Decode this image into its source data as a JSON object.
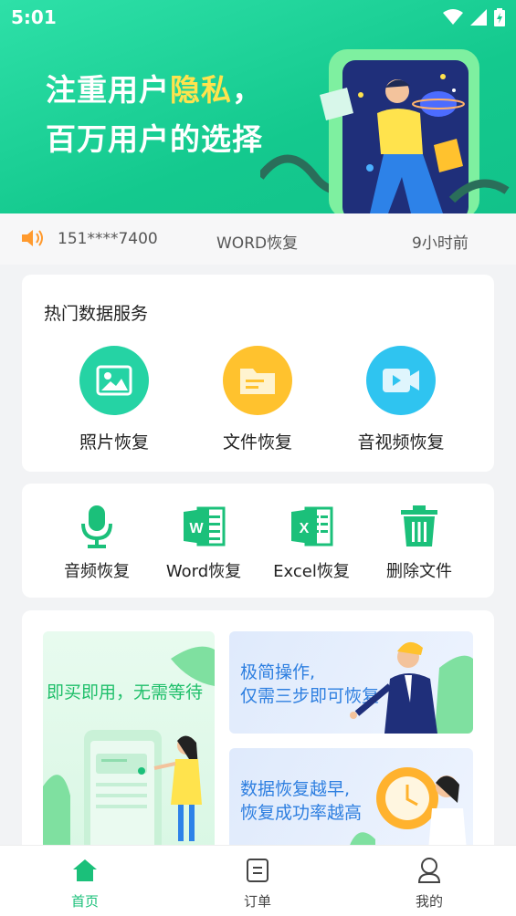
{
  "status_bar": {
    "time": "5:01"
  },
  "hero": {
    "line1_prefix": "注重用户",
    "line1_highlight": "隐私",
    "line1_suffix": "，",
    "line2": "百万用户的选择"
  },
  "ticker": {
    "phone": "151****7400",
    "service": "WORD恢复",
    "time_ago": "9小时前"
  },
  "hot_services": {
    "title": "热门数据服务",
    "items": [
      {
        "label": "照片恢复",
        "icon": "image-icon",
        "color": "#25d3a4"
      },
      {
        "label": "文件恢复",
        "icon": "folder-icon",
        "color": "#ffc22e"
      },
      {
        "label": "音视频恢复",
        "icon": "video-icon",
        "color": "#2fc4f0"
      }
    ]
  },
  "tools": [
    {
      "label": "音频恢复",
      "icon": "microphone-icon"
    },
    {
      "label": "Word恢复",
      "icon": "word-icon"
    },
    {
      "label": "Excel恢复",
      "icon": "excel-icon"
    },
    {
      "label": "删除文件",
      "icon": "trash-icon"
    }
  ],
  "promos": {
    "left": "即买即用，无需等待",
    "right1_line1": "极简操作,",
    "right1_line2": "仅需三步即可恢复",
    "right2_line1": "数据恢复越早,",
    "right2_line2": "恢复成功率越高"
  },
  "tabbar": {
    "home": "首页",
    "orders": "订单",
    "mine": "我的"
  },
  "colors": {
    "brand": "#1bc07a",
    "accent_yellow": "#ffe34d",
    "promo_blue": "#2e7fe0"
  }
}
